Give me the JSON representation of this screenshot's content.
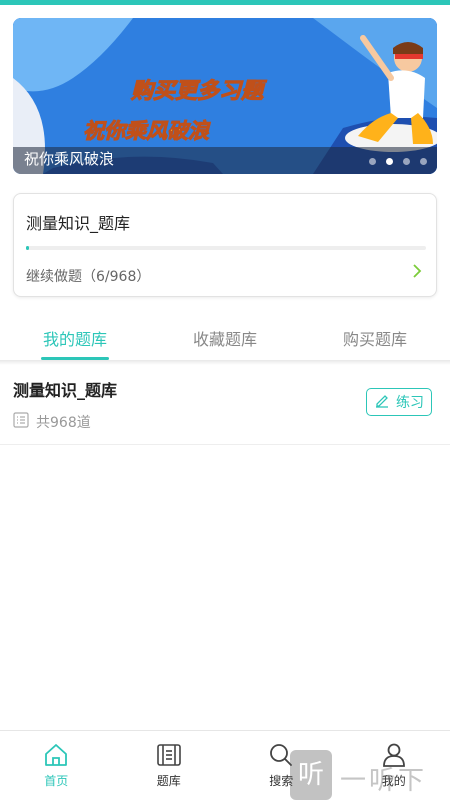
{
  "colors": {
    "accent": "#2cc6b8",
    "banner_blue": "#2f7fe0",
    "banner_orange": "#ffb21a"
  },
  "banner": {
    "headline": "购买更多习题",
    "tagline": "祝你乘风破浪",
    "caption": "祝你乘风破浪",
    "slide_count": 4,
    "active_slide": 2
  },
  "progress_card": {
    "title": "测量知识_题库",
    "progress_text": "继续做题（6/968）",
    "done": 6,
    "total": 968,
    "chevron_icon": "chevron-right-icon"
  },
  "tabs": [
    {
      "label": "我的题库",
      "active": true
    },
    {
      "label": "收藏题库",
      "active": false
    },
    {
      "label": "购买题库",
      "active": false
    }
  ],
  "question_bank": {
    "title": "测量知识_题库",
    "count_text": "共968道",
    "count_icon": "list-icon",
    "practice_label": "练习",
    "practice_icon": "pencil-icon"
  },
  "bottom_nav": [
    {
      "label": "首页",
      "icon": "home-icon",
      "active": true
    },
    {
      "label": "题库",
      "icon": "question-bank-icon",
      "active": false
    },
    {
      "label": "搜索",
      "icon": "search-icon",
      "active": false
    },
    {
      "label": "我的",
      "icon": "user-icon",
      "active": false
    }
  ],
  "watermark": {
    "badge": "听",
    "text": "一听下载"
  }
}
